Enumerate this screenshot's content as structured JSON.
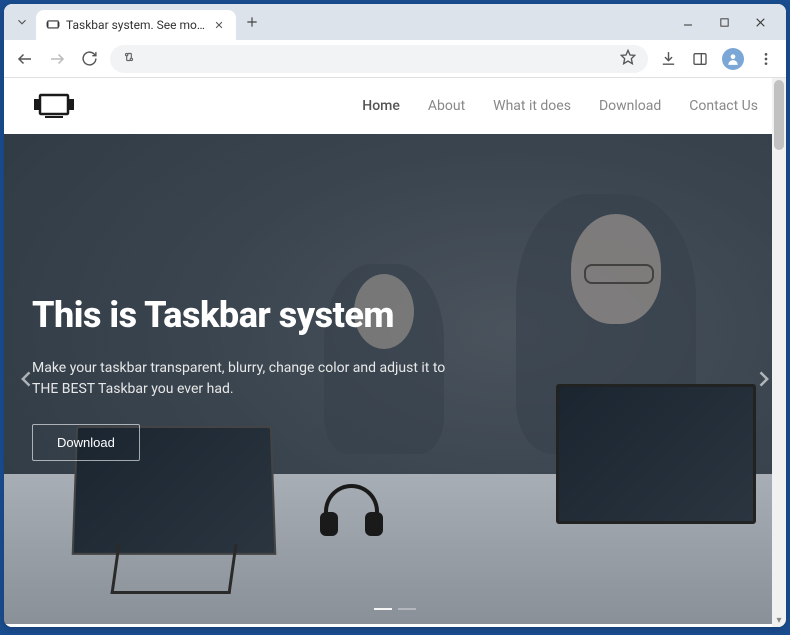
{
  "browser": {
    "tab_title": "Taskbar system. See more - do...",
    "star_tooltip": "Bookmark"
  },
  "site": {
    "nav": {
      "home": "Home",
      "about": "About",
      "what": "What it does",
      "download": "Download",
      "contact": "Contact Us"
    }
  },
  "hero": {
    "title": "This is Taskbar system",
    "description": "Make your taskbar transparent, blurry, change color and adjust it to THE BEST Taskbar you ever had.",
    "cta": "Download"
  }
}
